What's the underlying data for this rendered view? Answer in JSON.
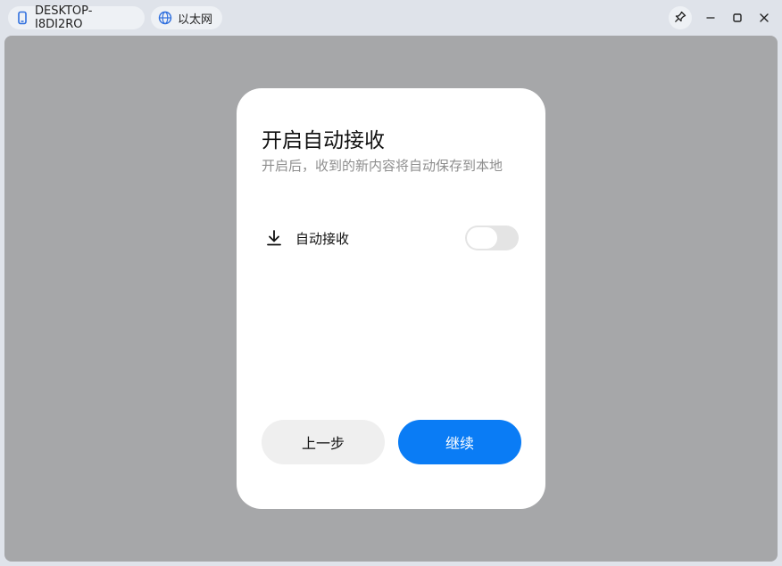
{
  "titlebar": {
    "device_name": "DESKTOP-I8DI2RO",
    "network_name": "以太网",
    "icons": {
      "device": "phone-icon",
      "network": "globe-icon",
      "pin": "pin-icon",
      "minimize": "minimize-icon",
      "maximize": "maximize-icon",
      "close": "close-icon"
    }
  },
  "dialog": {
    "title": "开启自动接收",
    "subtitle": "开启后，收到的新内容将自动保存到本地",
    "setting": {
      "label": "自动接收",
      "icon": "download-icon",
      "enabled": false
    },
    "back_label": "上一步",
    "continue_label": "继续"
  },
  "colors": {
    "accent": "#0a7cf5",
    "overlay": "#a6a7a9",
    "window_bg": "#dfe3ea"
  }
}
